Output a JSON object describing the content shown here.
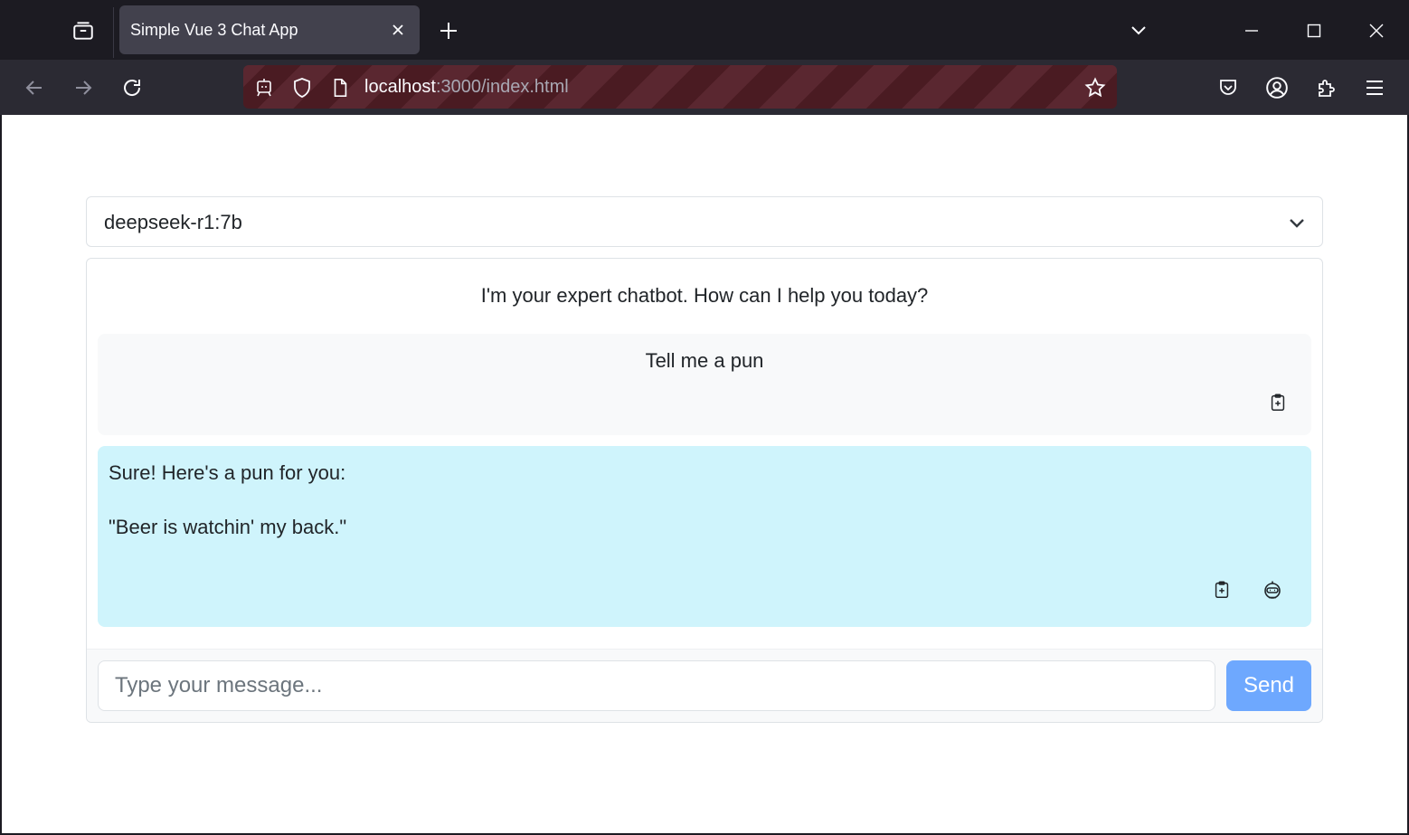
{
  "browser": {
    "tab_title": "Simple Vue 3 Chat App",
    "url_host": "localhost",
    "url_rest": ":3000/index.html",
    "icons": {
      "tab_list": "tab-list-icon",
      "close_tab": "close-icon",
      "new_tab": "plus-icon",
      "list_all_tabs": "chevron-down-icon",
      "minimize": "minimize-icon",
      "maximize": "maximize-icon",
      "close_window": "close-icon",
      "back": "arrow-left-icon",
      "forward": "arrow-right-icon",
      "reload": "reload-icon",
      "remote_control": "robot-icon",
      "tracking_protection": "shield-icon",
      "page_info": "page-icon",
      "bookmark": "star-icon",
      "pocket": "pocket-icon",
      "account": "account-icon",
      "extensions": "puzzle-icon",
      "menu": "hamburger-icon"
    }
  },
  "chat": {
    "model_selected": "deepseek-r1:7b",
    "greeting": "I'm your expert chatbot. How can I help you today?",
    "messages": [
      {
        "role": "user",
        "text": "Tell me a pun"
      },
      {
        "role": "assistant",
        "lines": [
          "Sure! Here's a pun for you:",
          "\"Beer is watchin' my back.\""
        ]
      }
    ],
    "input_placeholder": "Type your message...",
    "send_label": "Send"
  },
  "colors": {
    "user_bubble": "#f8f9fa",
    "assistant_bubble": "#cff4fc",
    "send_button": "#6ea8fe",
    "urlbar_stripe_dark": "#4a1b22",
    "urlbar_stripe_light": "#5a2730"
  }
}
